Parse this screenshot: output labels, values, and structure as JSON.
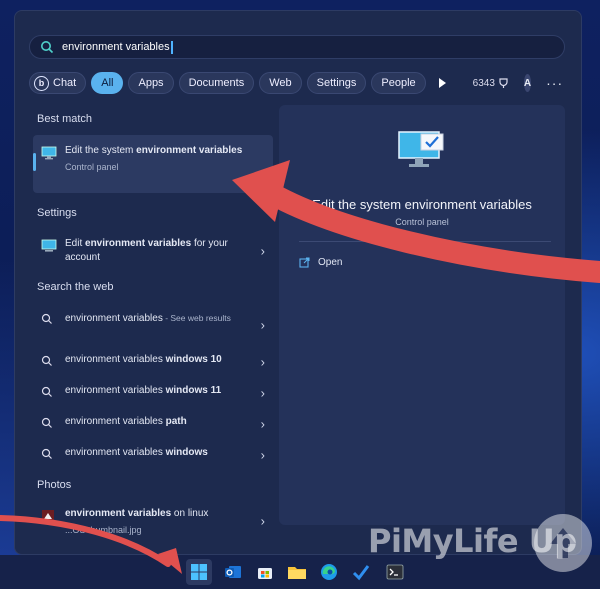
{
  "search": {
    "query": "environment variables"
  },
  "filters": {
    "chat": "Chat",
    "chat_icon": "b",
    "items": [
      "All",
      "Apps",
      "Documents",
      "Web",
      "Settings",
      "People"
    ],
    "points": "6343",
    "avatar_letter": "A",
    "more": "···",
    "bing_icon": "b"
  },
  "best_match": {
    "section": "Best match",
    "title_plain": "Edit the system ",
    "title_bold": "environment variables",
    "subtitle": "Control panel"
  },
  "settings": {
    "section": "Settings",
    "prefix": "Edit ",
    "bold": "environment variables",
    "suffix": " for your account"
  },
  "web": {
    "section": "Search the web",
    "items": [
      {
        "bold": "environment variables",
        "plain": " - See web results"
      },
      {
        "plain": "environment variables ",
        "bold": "windows 10"
      },
      {
        "plain": "environment variables ",
        "bold": "windows 11"
      },
      {
        "plain": "environment variables ",
        "bold": "path"
      },
      {
        "plain": "environment variables ",
        "bold": "windows"
      }
    ]
  },
  "photos": {
    "section": "Photos",
    "bold": "environment variables",
    "plain": " on linux",
    "file": "...OS thumbnail.jpg"
  },
  "detail": {
    "title": "Edit the system environment variables",
    "subtitle": "Control panel",
    "open_label": "Open"
  },
  "watermark": "PiMyLife Up",
  "colors": {
    "accent": "#5ab2ee",
    "arrow": "#e0504e",
    "panel": "#1d2a4e"
  }
}
